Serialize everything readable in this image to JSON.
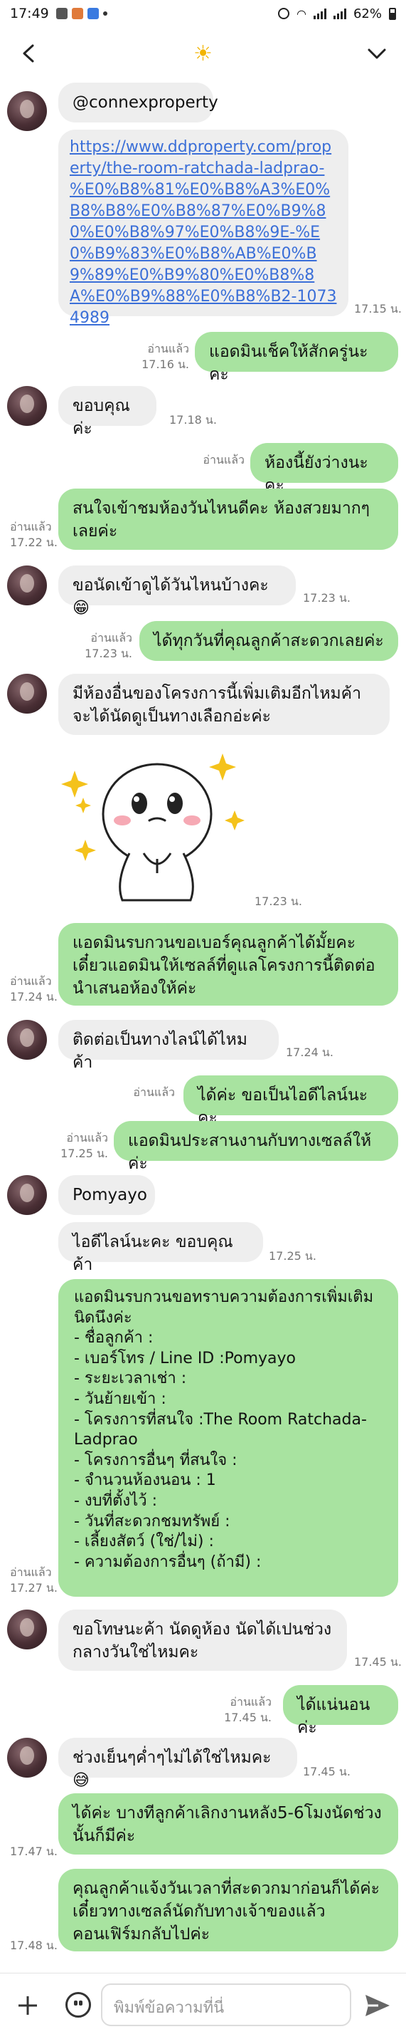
{
  "status": {
    "time": "17:49",
    "battery": "62%"
  },
  "header": {
    "title_icon": "sun-icon"
  },
  "messages": [
    {
      "text": "@connexproperty"
    },
    {
      "text": "https://www.ddproperty.com/property/the-room-ratchada-ladprao-%E0%B8%81%E0%B8%A3%E0%B8%B8%E0%B8%87%E0%B9%80%E0%B8%97%E0%B8%9E-%E0%B9%83%E0%B8%AB%E0%B9%89%E0%B9%80%E0%B8%8A%E0%B9%88%E0%B8%B2-10734989",
      "time": "17.15 น."
    },
    {
      "text": "แอดมินเช็คให้สักครู่นะคะ",
      "read": "อ่านแล้ว",
      "time": "17.16 น."
    },
    {
      "text": "ขอบคุณค่ะ",
      "time": "17.18 น."
    },
    {
      "text": "ห้องนี้ยังว่างนะคะ",
      "read": "อ่านแล้ว"
    },
    {
      "text": "สนใจเข้าชมห้องวันไหนดีคะ ห้องสวยมากๆ เลยค่ะ",
      "read": "อ่านแล้ว",
      "time": "17.22 น."
    },
    {
      "text": "ขอนัดเข้าดูได้วันไหนบ้างคะ😁",
      "time": "17.23 น."
    },
    {
      "text": "ได้ทุกวันที่คุณลูกค้าสะดวกเลยค่ะ",
      "read": "อ่านแล้ว",
      "time": "17.23 น."
    },
    {
      "text": "มีห้องอื่นของโครงการนี้เพิ่มเติมอีกไหมค้า จะได้นัดดูเป็นทางเลือกอ่ะค่ะ"
    },
    {
      "time": "17.23 น."
    },
    {
      "text": "แอดมินรบกวนขอเบอร์คุณลูกค้าได้มั้ยคะ เดี๋ยวแอดมินให้เซลล์ที่ดูแลโครงการนี้ติดต่อนำเสนอห้องให้ค่ะ",
      "read": "อ่านแล้ว",
      "time": "17.24 น."
    },
    {
      "text": "ติดต่อเป็นทางไลน์ได้ไหมค้า",
      "time": "17.24 น."
    },
    {
      "text": "ได้ค่ะ ขอเป็นไอดีไลน์นะคะ",
      "read": "อ่านแล้ว"
    },
    {
      "text": "แอดมินประสานงานกับทางเซลล์ให้ค่ะ",
      "read": "อ่านแล้ว",
      "time": "17.25 น."
    },
    {
      "text": "Pomyayo"
    },
    {
      "text": "ไอดีไลน์นะคะ ขอบคุณค้า",
      "time": "17.25 น."
    },
    {
      "text": "แอดมินรบกวนขอทราบความต้องการเพิ่มเติมนิดนึงค่ะ\n- ชื่อลูกค้า :\n- เบอร์โทร / Line ID :Pomyayo\n- ระยะเวลาเช่า :\n- วันย้ายเข้า :\n- โครงการที่สนใจ :The Room Ratchada-Ladprao\n- โครงการอื่นๆ ที่สนใจ :\n- จำนวนห้องนอน : 1\n- งบที่ตั้งไว้ :\n- วันที่สะดวกชมทรัพย์ :\n- เลี้ยงสัตว์ (ใช่/ไม่) :\n- ความต้องการอื่นๆ (ถ้ามี) :",
      "read": "อ่านแล้ว",
      "time": "17.27 น."
    },
    {
      "text": "ขอโทษนะค้า นัดดูห้อง นัดได้เปนช่วงกลางวันใช่ไหมคะ",
      "time": "17.45 น."
    },
    {
      "text": "ได้แน่นอนค่ะ",
      "read": "อ่านแล้ว",
      "time": "17.45 น."
    },
    {
      "text": "ช่วงเย็นๆค่ำๆไม่ได้ใช่ไหมคะ😅",
      "time": "17.45 น."
    },
    {
      "text": "ได้ค่ะ บางทีลูกค้าเลิกงานหลัง5-6โมงนัดช่วงนั้นก็มีค่ะ",
      "time": "17.47 น."
    },
    {
      "text": "คุณลูกค้าแจ้งวันเวลาที่สะดวกมาก่อนก็ได้ค่ะ เดี๋ยวทางเซลล์นัดกับทางเจ้าของแล้วคอนเฟิร์มกลับไปค่ะ",
      "time": "17.48 น."
    }
  ],
  "composer": {
    "placeholder": "พิมพ์ข้อความที่นี่"
  }
}
